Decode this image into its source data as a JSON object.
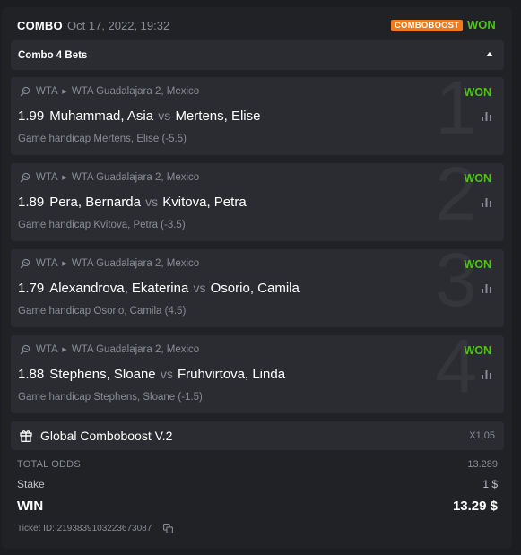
{
  "header": {
    "title": "COMBO",
    "date": "Oct 17, 2022, 19:32",
    "badge": "COMBOBOOST",
    "status": "WON"
  },
  "combo_bar": {
    "label": "Combo 4 Bets",
    "icon": "caret-up-icon"
  },
  "bets": [
    {
      "index": "1",
      "sport": "WTA",
      "league": "WTA Guadalajara 2, Mexico",
      "status": "WON",
      "odds": "1.99",
      "home": "Muhammad, Asia",
      "vs": "vs",
      "away": "Mertens, Elise",
      "market": "Game handicap Mertens, Elise (-5.5)"
    },
    {
      "index": "2",
      "sport": "WTA",
      "league": "WTA Guadalajara 2, Mexico",
      "status": "WON",
      "odds": "1.89",
      "home": "Pera, Bernarda",
      "vs": "vs",
      "away": "Kvitova, Petra",
      "market": "Game handicap Kvitova, Petra (-3.5)"
    },
    {
      "index": "3",
      "sport": "WTA",
      "league": "WTA Guadalajara 2, Mexico",
      "status": "WON",
      "odds": "1.79",
      "home": "Alexandrova, Ekaterina",
      "vs": "vs",
      "away": "Osorio, Camila",
      "market": "Game handicap Osorio, Camila (4.5)"
    },
    {
      "index": "4",
      "sport": "WTA",
      "league": "WTA Guadalajara 2, Mexico",
      "status": "WON",
      "odds": "1.88",
      "home": "Stephens, Sloane",
      "vs": "vs",
      "away": "Fruhvirtova, Linda",
      "market": "Game handicap Stephens, Sloane (-1.5)"
    }
  ],
  "boost": {
    "name": "Global Comboboost V.2",
    "multiplier": "X1.05",
    "icon": "gift-icon"
  },
  "summary": {
    "total_odds_label": "TOTAL ODDS",
    "total_odds_value": "13.289",
    "stake_label": "Stake",
    "stake_value": "1 $",
    "win_label": "WIN",
    "win_value": "13.29 $",
    "ticket_id": "Ticket ID: 2193839103223673087"
  },
  "colors": {
    "background": "#1b1d21",
    "card": "#202226",
    "panel": "#2a2c31",
    "won": "#4cc21b",
    "badge": "#f07a1a",
    "muted": "#8a8d93"
  }
}
